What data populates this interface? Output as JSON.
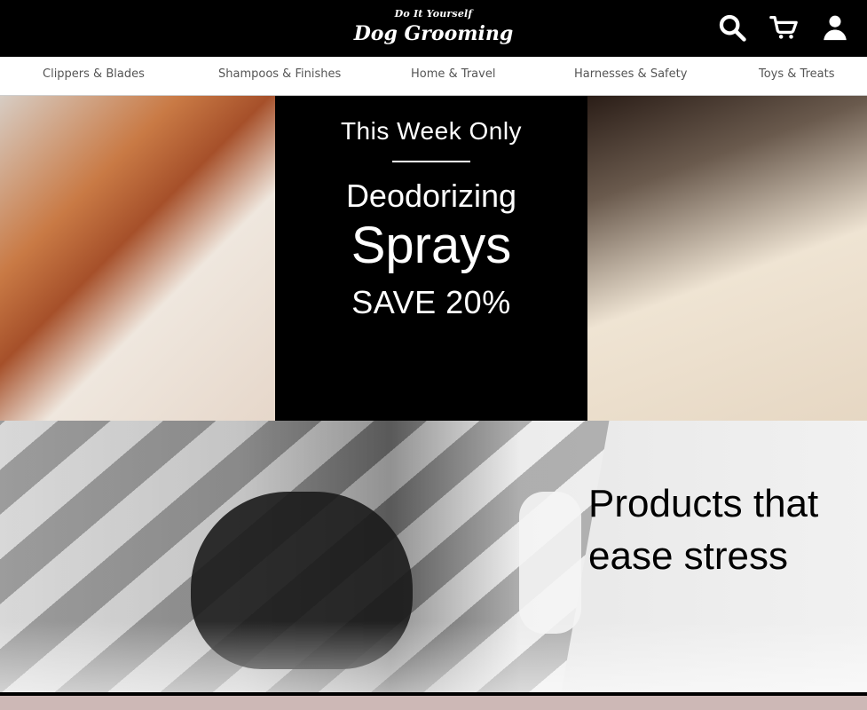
{
  "brand": {
    "small": "Do It Yourself",
    "big": "Dog Grooming"
  },
  "header_icons": [
    {
      "name": "search-icon"
    },
    {
      "name": "cart-icon"
    },
    {
      "name": "user-icon"
    }
  ],
  "nav": {
    "items": [
      {
        "label": "Clippers & Blades"
      },
      {
        "label": "Shampoos & Finishes"
      },
      {
        "label": "Home & Travel"
      },
      {
        "label": "Harnesses & Safety"
      },
      {
        "label": "Toys & Treats"
      }
    ]
  },
  "promo": {
    "kicker": "This Week Only",
    "line1": "Deodorizing",
    "line2": "Sprays",
    "line3": "SAVE 20%"
  },
  "feature": {
    "caption_line1": "Products that",
    "caption_line2": "ease stress"
  },
  "colors": {
    "header_bg": "#000000",
    "nav_text": "#555555",
    "strip": "#cdb8b6"
  }
}
